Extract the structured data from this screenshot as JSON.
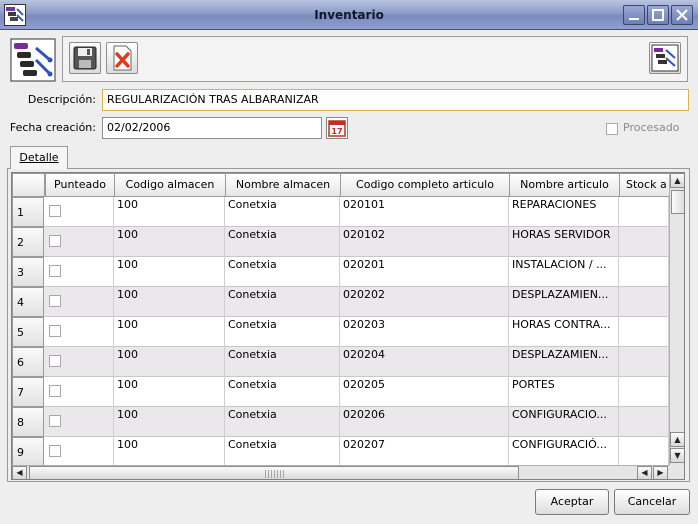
{
  "window": {
    "title": "Inventario",
    "minimize_glyph": "–",
    "maximize_glyph": "□",
    "close_glyph": "✕"
  },
  "toolbar": {
    "icons": [
      "app-logo-icon",
      "save-icon",
      "delete-icon",
      "app-small-icon"
    ]
  },
  "form": {
    "descripcion_label": "Descripción:",
    "descripcion_value": "REGULARIZACIÓN TRAS ALBARANIZAR",
    "fecha_label": "Fecha creación:",
    "fecha_value": "02/02/2006",
    "calendar_day": "17",
    "procesado_label": "Procesado",
    "procesado_checked": false
  },
  "tabs": [
    {
      "label": "Detalle",
      "active": true
    }
  ],
  "table": {
    "columns": [
      "Punteado",
      "Codigo almacen",
      "Nombre almacen",
      "Codigo completo articulo",
      "Nombre articulo",
      "Stock a"
    ],
    "rows": [
      {
        "num": "1",
        "punteado": false,
        "codigo_almacen": "100",
        "nombre_almacen": "Conetxia",
        "codigo_articulo": "020101",
        "nombre_articulo": "REPARACIONES",
        "stock": ""
      },
      {
        "num": "2",
        "punteado": false,
        "codigo_almacen": "100",
        "nombre_almacen": "Conetxia",
        "codigo_articulo": "020102",
        "nombre_articulo": "HORAS SERVIDOR",
        "stock": ""
      },
      {
        "num": "3",
        "punteado": false,
        "codigo_almacen": "100",
        "nombre_almacen": "Conetxia",
        "codigo_articulo": "020201",
        "nombre_articulo": "INSTALACION / ...",
        "stock": ""
      },
      {
        "num": "4",
        "punteado": false,
        "codigo_almacen": "100",
        "nombre_almacen": "Conetxia",
        "codigo_articulo": "020202",
        "nombre_articulo": "DESPLAZAMIEN...",
        "stock": ""
      },
      {
        "num": "5",
        "punteado": false,
        "codigo_almacen": "100",
        "nombre_almacen": "Conetxia",
        "codigo_articulo": "020203",
        "nombre_articulo": "HORAS CONTRA...",
        "stock": ""
      },
      {
        "num": "6",
        "punteado": false,
        "codigo_almacen": "100",
        "nombre_almacen": "Conetxia",
        "codigo_articulo": "020204",
        "nombre_articulo": "DESPLAZAMIEN...",
        "stock": ""
      },
      {
        "num": "7",
        "punteado": false,
        "codigo_almacen": "100",
        "nombre_almacen": "Conetxia",
        "codigo_articulo": "020205",
        "nombre_articulo": "PORTES",
        "stock": ""
      },
      {
        "num": "8",
        "punteado": false,
        "codigo_almacen": "100",
        "nombre_almacen": "Conetxia",
        "codigo_articulo": "020206",
        "nombre_articulo": "CONFIGURACIO...",
        "stock": ""
      },
      {
        "num": "9",
        "punteado": false,
        "codigo_almacen": "100",
        "nombre_almacen": "Conetxia",
        "codigo_articulo": "020207",
        "nombre_articulo": "CONFIGURACIÓ...",
        "stock": ""
      }
    ]
  },
  "buttons": {
    "aceptar": "Aceptar",
    "cancelar": "Cancelar"
  },
  "colors": {
    "titlebar": "#8c9cc8",
    "alt_row": "#ebe8ec",
    "focus_border": "#d9b44a",
    "delete_red": "#e03a1a"
  }
}
